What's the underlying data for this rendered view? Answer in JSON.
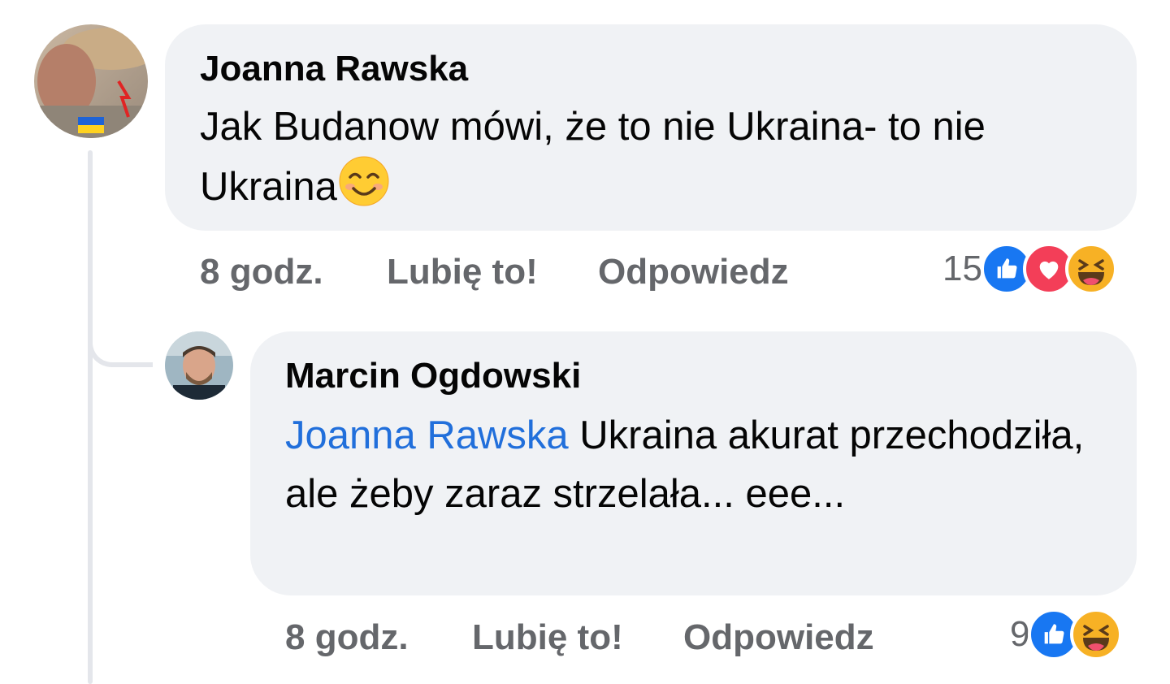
{
  "comments": [
    {
      "author": "Joanna Rawska",
      "text": "Jak Budanow mówi, że to nie Ukraina- to nie Ukraina",
      "emoji": "smiling-face-icon",
      "time": "8 godz.",
      "like_label": "Lubię to!",
      "reply_label": "Odpowiedz",
      "reaction_count": "15",
      "reactions": [
        "like-icon",
        "love-icon",
        "haha-icon"
      ]
    },
    {
      "author": "Marcin Ogdowski",
      "mention": "Joanna Rawska",
      "text": "Ukraina akurat przechodziła, ale żeby zaraz strzelała... eee...",
      "time": "8 godz.",
      "like_label": "Lubię to!",
      "reply_label": "Odpowiedz",
      "reaction_count": "9",
      "reactions": [
        "like-icon",
        "haha-icon"
      ]
    }
  ],
  "colors": {
    "bubble": "#f0f2f5",
    "mention": "#216fdb",
    "meta": "#65676b",
    "like": "#1877f2",
    "love": "#f33e58",
    "haha": "#f7b125"
  }
}
